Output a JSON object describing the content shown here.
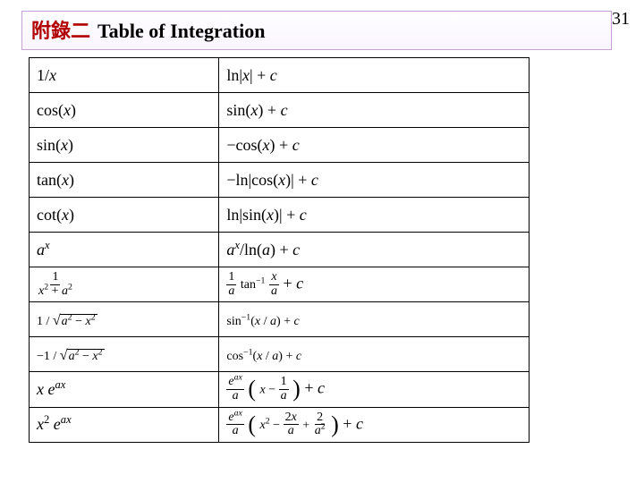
{
  "page_number": "31",
  "title_prefix": "附錄二",
  "title_main": "Table of Integration",
  "rows": {
    "r0": {
      "f_html": "1/<span class='it'>x</span>",
      "F_html": " ln|<span class='it'>x</span>| + <span class='it'>c</span>"
    },
    "r1": {
      "f_html": "cos(<span class='it'>x</span>)",
      "F_html": " sin(<span class='it'>x</span>) + <span class='it'>c</span>"
    },
    "r2": {
      "f_html": "sin(<span class='it'>x</span>)",
      "F_html": "−cos(<span class='it'>x</span>) + <span class='it'>c</span>"
    },
    "r3": {
      "f_html": "tan(<span class='it'>x</span>)",
      "F_html": "−ln|cos(<span class='it'>x</span>)| + <span class='it'>c</span>"
    },
    "r4": {
      "f_html": "cot(<span class='it'>x</span>)",
      "F_html": "ln|sin(<span class='it'>x</span>)| + <span class='it'>c</span>"
    },
    "r5": {
      "f_html": "<span class='it'>a</span><sup><span class='it'>x</span></sup>",
      "F_html": "<span class='it'>a</span><sup><span class='it'>x</span></sup>/ln(<span class='it'>a</span>) + <span class='it'>c</span>"
    },
    "r6": {
      "f_html": "<span class='frac'><span class='num'>1</span><span class='den'><span class='it'>x</span><sup>2</sup> + <span class='it'>a</span><sup>2</sup></span></span>",
      "F_html": "<span class='frac'><span class='num'>1</span><span class='den'><span class='it'>a</span></span></span> <span class='small'>tan<sup>−1</sup></span> <span class='frac'><span class='num'><span class='it'>x</span></span><span class='den'><span class='it'>a</span></span></span> + <span class='it'>c</span>"
    },
    "r7": {
      "f_html": "<span class='small'>1 / </span><span class='sqrt'><span class='rad'><span class='it'>a</span><sup>2</sup> − <span class='it'>x</span><sup>2</sup></span></span>",
      "F_html": "<span class='small'>sin<sup>−1</sup>(<span class='it'>x</span> / <span class='it'>a</span>) + <span class='it'>c</span></span>"
    },
    "r8": {
      "f_html": "<span class='small'>−1 / </span><span class='sqrt'><span class='rad'><span class='it'>a</span><sup>2</sup> − <span class='it'>x</span><sup>2</sup></span></span>",
      "F_html": "<span class='small'>cos<sup>−1</sup>(<span class='it'>x</span> / <span class='it'>a</span>) + <span class='it'>c</span></span>"
    },
    "r9": {
      "f_html": "<span class='it'>x</span> <span class='it'>e</span><sup><span class='it'>ax</span></sup>",
      "F_html": "<span class='frac'><span class='num'><span class='it'>e</span><sup><span class='it'>ax</span></sup></span><span class='den'><span class='it'>a</span></span></span> <span class='bigp'>(</span> <span class='small'><span class='it'>x</span> − </span><span class='frac'><span class='num'>1</span><span class='den'><span class='it'>a</span></span></span> <span class='bigp'>)</span> + <span class='it'>c</span>"
    },
    "r10": {
      "f_html": "<span class='it'>x</span><sup>2</sup> <span class='it'>e</span><sup><span class='it'>ax</span></sup>",
      "F_html": "<span class='frac'><span class='num'><span class='it'>e</span><sup><span class='it'>ax</span></sup></span><span class='den'><span class='it'>a</span></span></span> <span class='bigp'>(</span> <span class='small'><span class='it'>x</span><sup>2</sup> − </span><span class='frac'><span class='num'>2<span class='it'>x</span></span><span class='den'><span class='it'>a</span></span></span> <span class='small'>+ </span><span class='frac'><span class='num'>2</span><span class='den'><span class='it'>a</span><sup>2</sup></span></span> <span class='bigp'>)</span> + <span class='it'>c</span>"
    }
  }
}
